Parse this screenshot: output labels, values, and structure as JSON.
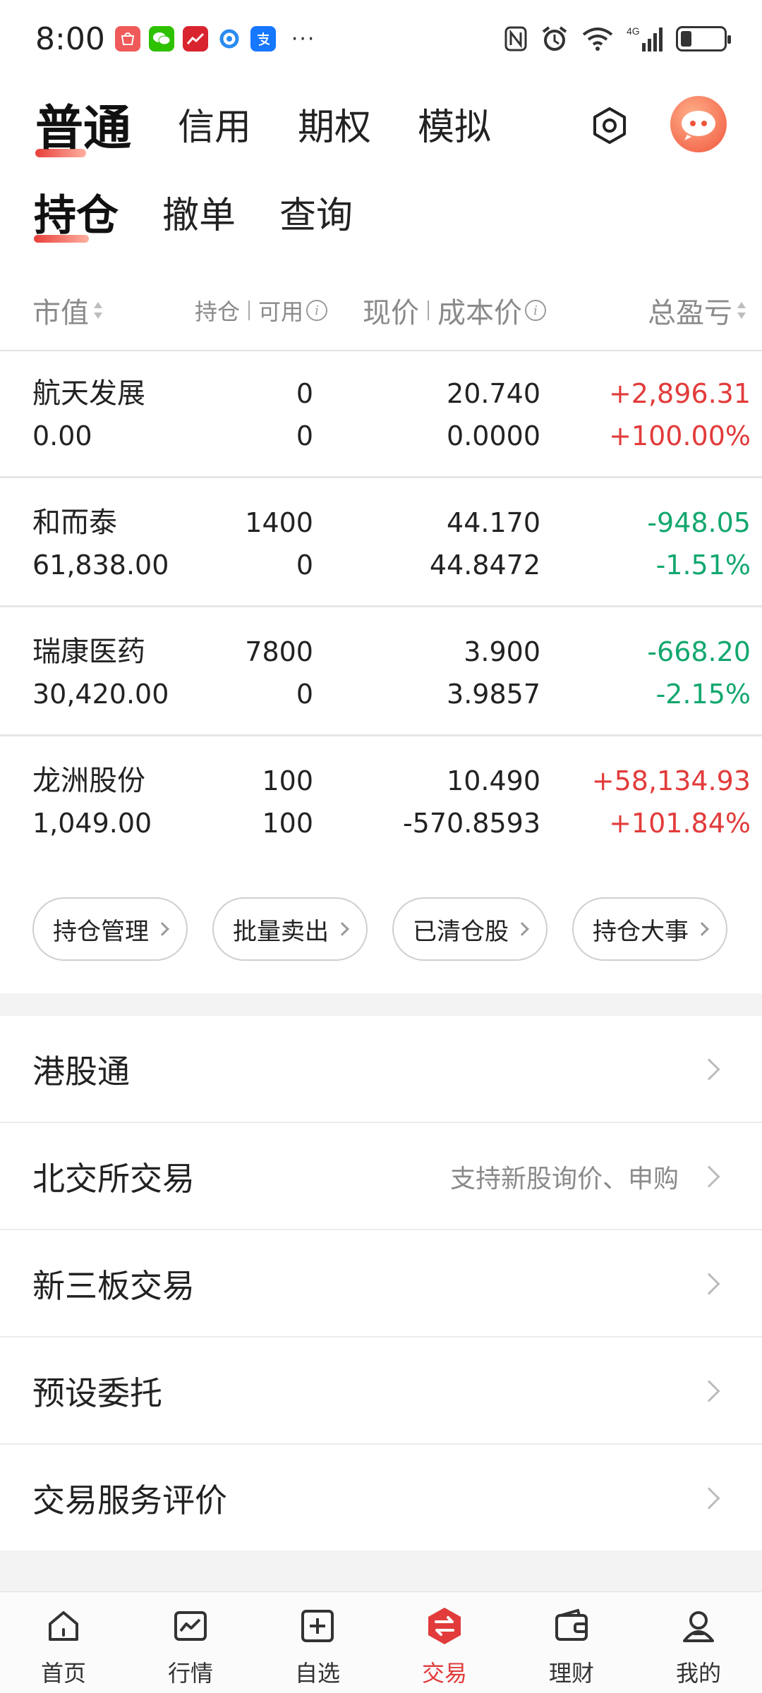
{
  "status_bar": {
    "time": "8:00",
    "more": "···",
    "network": "4G"
  },
  "top_tabs": [
    {
      "label": "普通",
      "active": true
    },
    {
      "label": "信用",
      "active": false
    },
    {
      "label": "期权",
      "active": false
    },
    {
      "label": "模拟",
      "active": false
    }
  ],
  "sub_tabs": [
    {
      "label": "持仓",
      "active": true
    },
    {
      "label": "撤单",
      "active": false
    },
    {
      "label": "查询",
      "active": false
    }
  ],
  "table_header": {
    "market_value": "市值",
    "position": "持仓",
    "available": "可用",
    "price": "现价",
    "cost": "成本价",
    "pnl": "总盈亏"
  },
  "positions": [
    {
      "name": "航天发展",
      "market_value": "0.00",
      "position": "0",
      "available": "0",
      "price": "20.740",
      "cost": "0.0000",
      "pnl": "+2,896.31",
      "pnl_pct": "+100.00%",
      "direction": "up"
    },
    {
      "name": "和而泰",
      "market_value": "61,838.00",
      "position": "1400",
      "available": "0",
      "price": "44.170",
      "cost": "44.8472",
      "pnl": "-948.05",
      "pnl_pct": "-1.51%",
      "direction": "down"
    },
    {
      "name": "瑞康医药",
      "market_value": "30,420.00",
      "position": "7800",
      "available": "0",
      "price": "3.900",
      "cost": "3.9857",
      "pnl": "-668.20",
      "pnl_pct": "-2.15%",
      "direction": "down"
    },
    {
      "name": "龙洲股份",
      "market_value": "1,049.00",
      "position": "100",
      "available": "100",
      "price": "10.490",
      "cost": "-570.8593",
      "pnl": "+58,134.93",
      "pnl_pct": "+101.84%",
      "direction": "up"
    }
  ],
  "actions": [
    "持仓管理",
    "批量卖出",
    "已清仓股",
    "持仓大事"
  ],
  "menu": [
    {
      "label": "港股通",
      "hint": ""
    },
    {
      "label": "北交所交易",
      "hint": "支持新股询价、申购"
    },
    {
      "label": "新三板交易",
      "hint": ""
    },
    {
      "label": "预设委托",
      "hint": ""
    },
    {
      "label": "交易服务评价",
      "hint": ""
    }
  ],
  "bottom_nav": [
    {
      "label": "首页",
      "icon": "home-icon",
      "active": false
    },
    {
      "label": "行情",
      "icon": "market-chart-icon",
      "active": false
    },
    {
      "label": "自选",
      "icon": "add-watchlist-icon",
      "active": false
    },
    {
      "label": "交易",
      "icon": "trade-icon",
      "active": true
    },
    {
      "label": "理财",
      "icon": "wallet-icon",
      "active": false
    },
    {
      "label": "我的",
      "icon": "profile-icon",
      "active": false
    }
  ],
  "colors": {
    "up": "#e23b3b",
    "down": "#13a76e",
    "accent": "#e23b3b"
  }
}
